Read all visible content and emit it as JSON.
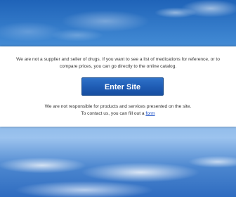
{
  "intro": {
    "line1": "We are not a supplier and seller of drugs. If you want to see a list of medications for reference, or to",
    "line2": "compare prices, you can go directly to the online catalog."
  },
  "enter_button": {
    "label": "Enter Site"
  },
  "disclaimer": {
    "line1": "We are not responsible for products and services presented on the site.",
    "line2_prefix": "To contact us, you can fill out a",
    "link_label": "form"
  },
  "colors": {
    "button": "#1e5bb3",
    "link": "#1a4fc7",
    "sky": "#3e86d1"
  }
}
